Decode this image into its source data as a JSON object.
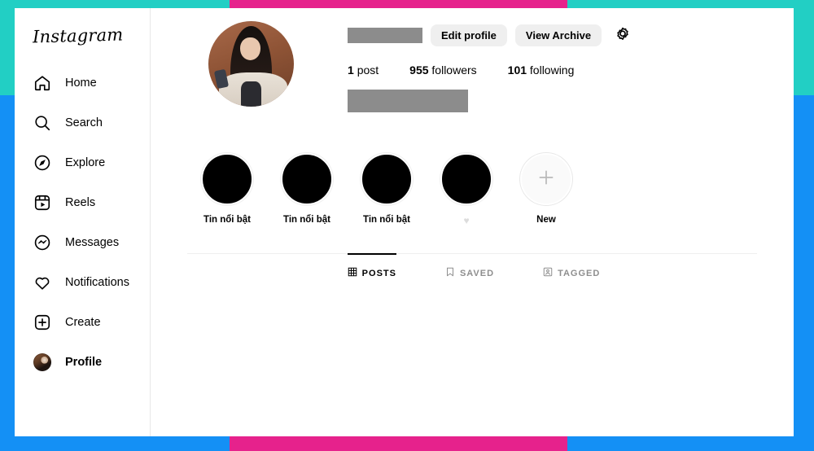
{
  "frame": {
    "teal": "#22cfc4",
    "pink": "#e6228c",
    "blue": "#1490f5"
  },
  "sidebar": {
    "brand": "Instagram",
    "items": [
      {
        "label": "Home",
        "icon": "home-icon",
        "active": false
      },
      {
        "label": "Search",
        "icon": "search-icon",
        "active": false
      },
      {
        "label": "Explore",
        "icon": "compass-icon",
        "active": false
      },
      {
        "label": "Reels",
        "icon": "reels-icon",
        "active": false
      },
      {
        "label": "Messages",
        "icon": "messenger-icon",
        "active": false
      },
      {
        "label": "Notifications",
        "icon": "heart-icon",
        "active": false
      },
      {
        "label": "Create",
        "icon": "plus-square-icon",
        "active": false
      },
      {
        "label": "Profile",
        "icon": "avatar-icon",
        "active": true
      }
    ]
  },
  "profile": {
    "avatar_alt": "profile-photo",
    "username_redacted": true,
    "bio_redacted": true,
    "buttons": {
      "edit_profile": "Edit profile",
      "view_archive": "View Archive",
      "settings_icon": "gear-icon"
    },
    "stats": [
      {
        "count": "1",
        "label": "post"
      },
      {
        "count": "955",
        "label": "followers"
      },
      {
        "count": "101",
        "label": "following"
      }
    ]
  },
  "highlights": [
    {
      "label": "Tin nổi bật",
      "type": "cover"
    },
    {
      "label": "Tin nổi bật",
      "type": "cover"
    },
    {
      "label": "Tin nổi bật",
      "type": "cover"
    },
    {
      "label": "♥",
      "type": "cover"
    },
    {
      "label": "New",
      "type": "new"
    }
  ],
  "tabs": [
    {
      "label": "POSTS",
      "icon": "grid-icon",
      "active": true
    },
    {
      "label": "SAVED",
      "icon": "bookmark-icon",
      "active": false
    },
    {
      "label": "TAGGED",
      "icon": "tagged-icon",
      "active": false
    }
  ]
}
